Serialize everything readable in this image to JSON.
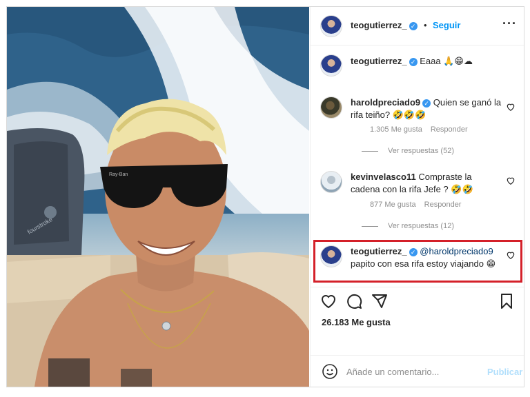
{
  "post": {
    "author": "teogutierrez_",
    "follow_label": "Seguir",
    "separator": "•",
    "more_label": "···",
    "caption_author": "teogutierrez_",
    "caption_text": "Eaaa 🙏😁☁"
  },
  "comments": [
    {
      "author": "haroldpreciado9",
      "text": "Quien se ganó la rifa teiño? 🤣🤣🤣",
      "likes": "1.305 Me gusta",
      "reply_label": "Responder",
      "view_replies": "Ver respuestas (52)"
    },
    {
      "author": "kevinvelasco11",
      "text": "Compraste la cadena con la rifa Jefe ? 🤣🤣",
      "likes": "877 Me gusta",
      "reply_label": "Responder",
      "view_replies": "Ver respuestas (12)"
    },
    {
      "author": "teogutierrez_",
      "mention": "@haroldpreciado9",
      "text": "papito con esa rifa estoy viajando 😁"
    }
  ],
  "footer": {
    "likes_count": "26.183 Me gusta",
    "comment_placeholder": "Añade un comentario...",
    "publish_label": "Publicar"
  },
  "colors": {
    "link_blue": "#0095f6",
    "verified_blue": "#3897f0",
    "highlight_red": "#d42029",
    "muted_gray": "#8e8e8e"
  },
  "icons": [
    "verified-icon",
    "more-icon",
    "heart-icon",
    "comment-icon",
    "share-icon",
    "bookmark-icon",
    "emoji-icon"
  ]
}
